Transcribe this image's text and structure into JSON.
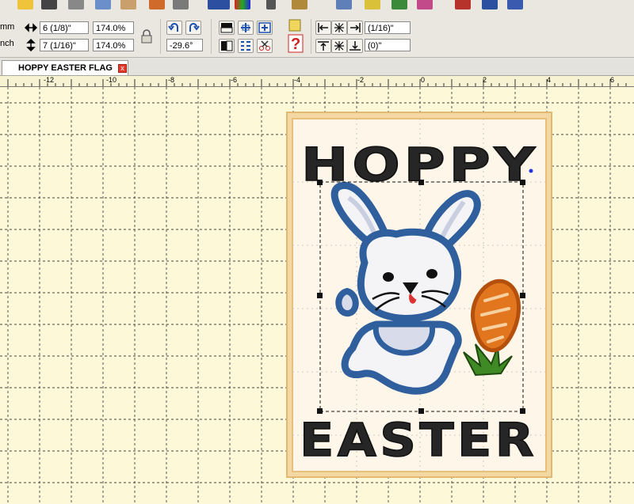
{
  "toolbar": {
    "unit_mm": "mm",
    "unit_inch": "nch",
    "width_value": "6 (1/8)\"",
    "height_value": "7 (1/16)\"",
    "width_scale": "174.0%",
    "height_scale": "174.0%",
    "rotation_value": "-29.6°",
    "offset_x_value": "(1/16)\"",
    "offset_y_value": "(0)\"",
    "icons": [
      "open-icon",
      "save-icon",
      "print-icon",
      "copy-icon",
      "paste-icon",
      "scissors-icon",
      "3d-icon",
      "colors-icon",
      "wand-icon",
      "pen-icon",
      "hand-icon",
      "view-icon",
      "font-icon",
      "palette-icon",
      "text-icon",
      "tools-icon"
    ]
  },
  "tab": {
    "title": "HOPPY EASTER FLAG",
    "close_glyph": "x"
  },
  "ruler": {
    "labels": [
      "-12",
      "-10",
      "-8",
      "-6",
      "-4",
      "-2",
      "0",
      "2",
      "4",
      "6"
    ]
  },
  "design": {
    "top_text": "HOPPY",
    "bottom_text": "EASTER",
    "colors": {
      "bunny_outline": "#2f5f9c",
      "bunny_fill": "#f4f4f7",
      "carrot": "#e2761f",
      "leaves": "#3f8a25",
      "frame_outer": "#f4d8a4",
      "frame_inner": "#fdf6e9",
      "thread_dark": "#262626",
      "canvas": "#fdf8d8",
      "grid": "#333333"
    }
  }
}
